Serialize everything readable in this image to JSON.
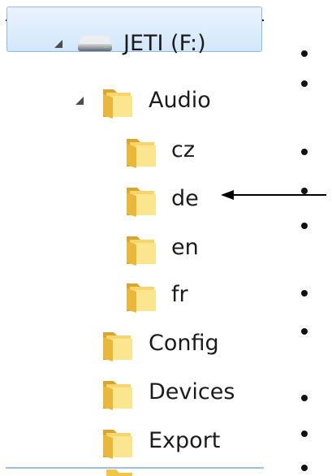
{
  "tree": {
    "drive": {
      "label": "JETI (F:)"
    },
    "audio": {
      "label": "Audio"
    },
    "languages": [
      {
        "label": "cz"
      },
      {
        "label": "de"
      },
      {
        "label": "en"
      },
      {
        "label": "fr"
      }
    ],
    "folders": [
      {
        "label": "Config"
      },
      {
        "label": "Devices"
      },
      {
        "label": "Export"
      }
    ]
  },
  "colors": {
    "selection": "#d3e7fc",
    "selection_border": "#8fb9e6",
    "folder": "#f2c448",
    "text": "#1b1b1b"
  }
}
